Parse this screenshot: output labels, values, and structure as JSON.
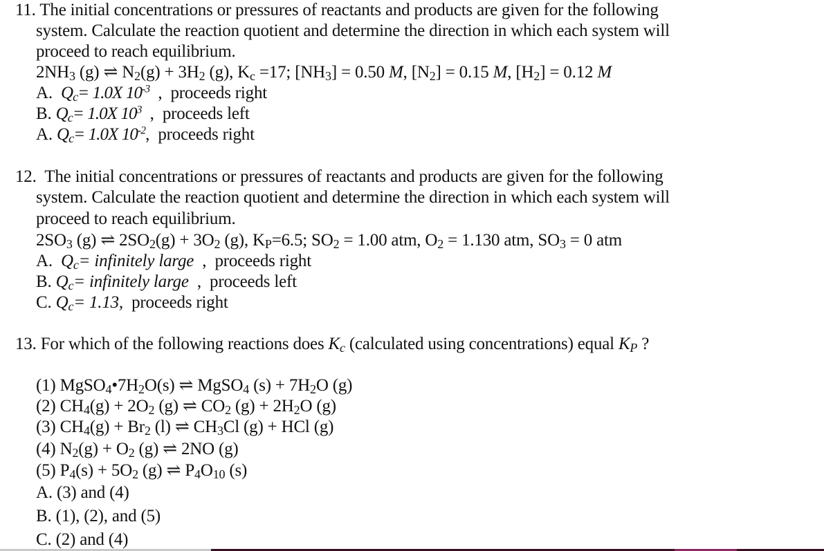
{
  "questions": [
    {
      "number": "11.",
      "stem": [
        "The initial concentrations or pressures of reactants and products are given for the following",
        "system. Calculate the reaction quotient and determine the direction in which each system will",
        "proceed to reach equilibrium."
      ],
      "reaction": {
        "equation": "2NH3 (g) ⇌ N2(g) + 3H2 (g)",
        "constant": "Kc =17",
        "conditions": "[NH3] = 0.50 M, [N2] = 0.15 M, [H2] = 0.12 M"
      },
      "options": [
        {
          "letter": "A.",
          "q_label": "Qc",
          "value": "1.0X 10",
          "exponent": "-3",
          "direction": "proceeds right"
        },
        {
          "letter": "B.",
          "q_label": "Qc",
          "value": "1.0X 10",
          "exponent": "3",
          "direction": "proceeds left"
        },
        {
          "letter": "A.",
          "q_label": "Qc",
          "value": "1.0X 10",
          "exponent": "-2",
          "direction": "proceeds right"
        }
      ]
    },
    {
      "number": "12.",
      "stem": [
        "The initial concentrations or pressures of reactants and products are given for the following",
        "system. Calculate the reaction quotient and determine the direction in which each system will",
        "proceed to reach equilibrium."
      ],
      "reaction": {
        "equation": "2SO3 (g) ⇌ 2SO2(g) + 3O2 (g)",
        "constant": "KP=6.5",
        "conditions": "SO2 = 1.00 atm, O2 = 1.130 atm, SO3 = 0 atm"
      },
      "options": [
        {
          "letter": "A.",
          "q_label": "Qc",
          "value": "infinitely large",
          "direction": "proceeds right"
        },
        {
          "letter": "B.",
          "q_label": "Qc",
          "value": "infinitely large",
          "direction": "proceeds left"
        },
        {
          "letter": "C.",
          "q_label": "Qc",
          "value": "1.13,",
          "direction": "proceeds right"
        }
      ]
    },
    {
      "number": "13.",
      "stem": [
        "For which of the following reactions does Kc (calculated using concentrations) equal KP ?"
      ],
      "reactions": [
        "(1) MgSO4•7H2O(s) ⇌ MgSO4 (s) + 7H2O (g)",
        "(2) CH4(g) + 2O2 (g) ⇌ CO2 (g) + 2H2O (g)",
        "(3) CH4(g) + Br2 (l) ⇌ CH3Cl (g) + HCl (g)",
        "(4) N2(g) + O2 (g) ⇌ 2NO (g)",
        "(5) P4(s) + 5O2 (g) ⇌ P4O10 (s)"
      ],
      "options": [
        {
          "letter": "A.",
          "text": "(3) and (4)"
        },
        {
          "letter": "B.",
          "text": "(1), (2), and (5)"
        },
        {
          "letter": "C.",
          "text": "(2) and (4)"
        }
      ]
    }
  ],
  "text": {
    "comma": ",",
    "eq_sign": "=",
    "for_which": "For which of the following reactions does ",
    "calc_using": " (calculated using concentrations) equal ",
    "qmark": " ?",
    "q11_eq_a": "2NH",
    "q11_eq_b": "3",
    "q11_eq_c": " (g) ⇌ N",
    "q11_eq_d": "2",
    "q11_eq_e": "(g) + 3H",
    "q11_eq_f": "2",
    "q11_eq_g": " (g), K",
    "q11_eq_h": "c",
    "q11_eq_i": " =17; [NH",
    "q11_eq_j": "3",
    "q11_eq_k": "] = 0.50 ",
    "q11_eq_l": "M",
    "q11_eq_m": ", [N",
    "q11_eq_n": "2",
    "q11_eq_o": "] = 0.15 ",
    "q11_eq_p": "M",
    "q11_eq_q": ", [H",
    "q11_eq_r": "2",
    "q11_eq_s": "] = 0.12 ",
    "q11_eq_t": "M",
    "q12_eq_a": "2SO",
    "q12_eq_b": "3",
    "q12_eq_c": " (g) ⇌ 2SO",
    "q12_eq_d": "2",
    "q12_eq_e": "(g) + 3O",
    "q12_eq_f": "2",
    "q12_eq_g": " (g), K",
    "q12_eq_h": "P",
    "q12_eq_i": "=6.5; SO",
    "q12_eq_j": "2",
    "q12_eq_k": " = 1.00 atm, O",
    "q12_eq_l": "2",
    "q12_eq_m": " = 1.130 atm, SO",
    "q12_eq_n": "3",
    "q12_eq_o": " = 0 atm",
    "r1_a": "(1) MgSO",
    "r1_b": "4",
    "r1_c": "•7H",
    "r1_d": "2",
    "r1_e": "O(s) ⇌ MgSO",
    "r1_f": "4",
    "r1_g": " (s) + 7H",
    "r1_h": "2",
    "r1_i": "O (g)",
    "r2_a": "(2) CH",
    "r2_b": "4",
    "r2_c": "(g) + 2O",
    "r2_d": "2",
    "r2_e": " (g) ⇌ CO",
    "r2_f": "2",
    "r2_g": " (g) + 2H",
    "r2_h": "2",
    "r2_i": "O (g)",
    "r3_a": "(3) CH",
    "r3_b": "4",
    "r3_c": "(g) + Br",
    "r3_d": "2",
    "r3_e": " (l) ⇌ CH",
    "r3_f": "3",
    "r3_g": "Cl (g) + HCl (g)",
    "r4_a": "(4) N",
    "r4_b": "2",
    "r4_c": "(g) + O",
    "r4_d": "2",
    "r4_e": " (g) ⇌ 2NO (g)",
    "r5_a": "(5) P",
    "r5_b": "4",
    "r5_c": "(s) + 5O",
    "r5_d": "2",
    "r5_e": " (g) ⇌ P",
    "r5_f": "4",
    "r5_g": "O",
    "r5_h": "10",
    "r5_i": " (s)",
    "Q": "Q",
    "c": "c",
    "K": "K",
    "P": "P"
  },
  "colors": {
    "text": "#111111",
    "background": "#ffffff",
    "bottom_bar": "#3a0f22",
    "bottom_bar_grey": "#c9c9c9",
    "bottom_bar_accent": "#8a2a62"
  }
}
